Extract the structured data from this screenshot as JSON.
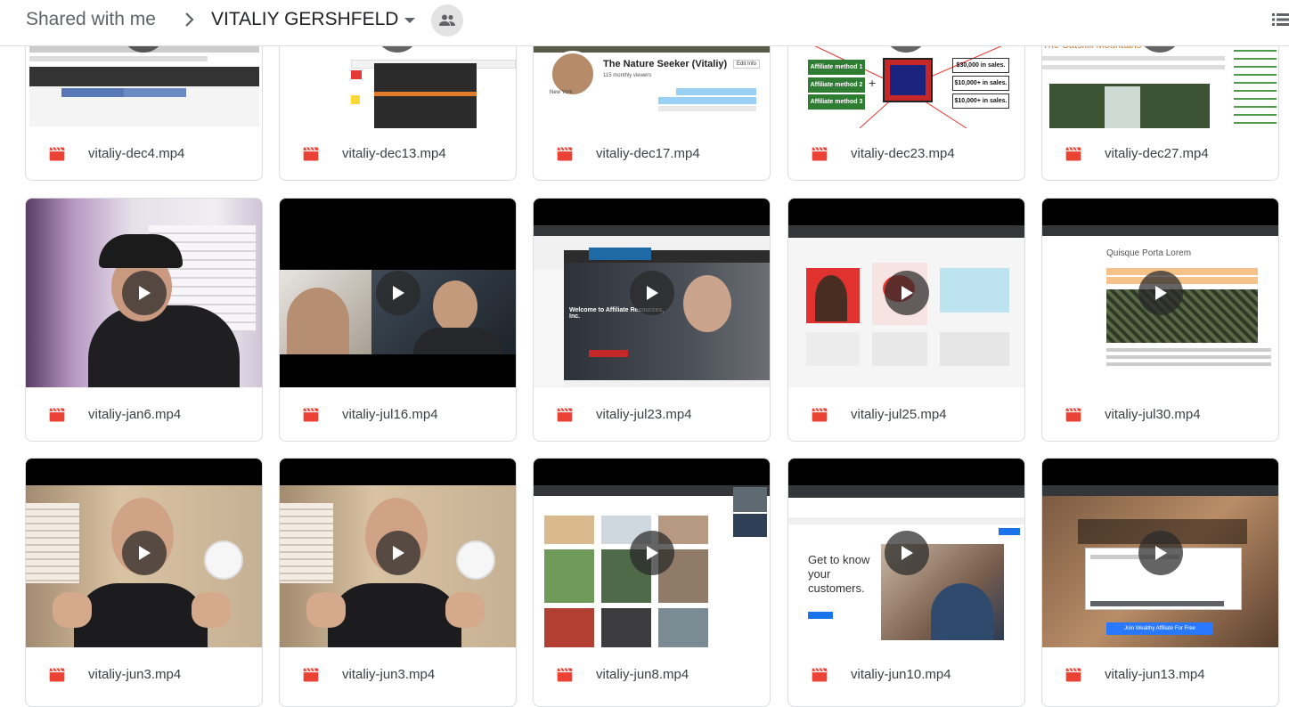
{
  "breadcrumb": {
    "root": "Shared with me",
    "folder": "VITALIY GERSHFELD"
  },
  "icons": {
    "separator": "chevron-right-icon",
    "caret": "caret-down-icon",
    "shared": "people-icon",
    "view": "list-view-icon",
    "file": "video-file-icon",
    "play": "play-icon"
  },
  "colors": {
    "video_icon": "#ea4335",
    "border": "#dadce0",
    "text": "#3c4043"
  },
  "thumbnail_text": {
    "nature": {
      "title": "The Nature Seeker (Vitaliy)",
      "viewers": "115 monthly viewers",
      "edit": "Edit Info",
      "location": "New York"
    },
    "methods": {
      "m1": "Affiliate method 1",
      "m2": "Affiliate method 2",
      "m3": "Affiliate method 3",
      "s1": "$30,000 in sales.",
      "s2": "$10,000+ in sales.",
      "s3": "$10,000+ in sales."
    },
    "catskill": "The Catskill Mountains",
    "affiliate_welcome": "Welcome to Affiliate Resources, Inc.",
    "lorem": "Quisque Porta Lorem",
    "get_to_know": [
      "Get to know",
      "your",
      "customers."
    ],
    "wealthy_button": "Join Wealthy Affiliate For Free"
  },
  "files": [
    {
      "name": "vitaliy-dec4.mp4"
    },
    {
      "name": "vitaliy-dec13.mp4"
    },
    {
      "name": "vitaliy-dec17.mp4"
    },
    {
      "name": "vitaliy-dec23.mp4"
    },
    {
      "name": "vitaliy-dec27.mp4"
    },
    {
      "name": "vitaliy-jan6.mp4"
    },
    {
      "name": "vitaliy-jul16.mp4"
    },
    {
      "name": "vitaliy-jul23.mp4"
    },
    {
      "name": "vitaliy-jul25.mp4"
    },
    {
      "name": "vitaliy-jul30.mp4"
    },
    {
      "name": "vitaliy-jun3.mp4"
    },
    {
      "name": "vitaliy-jun3.mp4"
    },
    {
      "name": "vitaliy-jun8.mp4"
    },
    {
      "name": "vitaliy-jun10.mp4"
    },
    {
      "name": "vitaliy-jun13.mp4"
    }
  ]
}
